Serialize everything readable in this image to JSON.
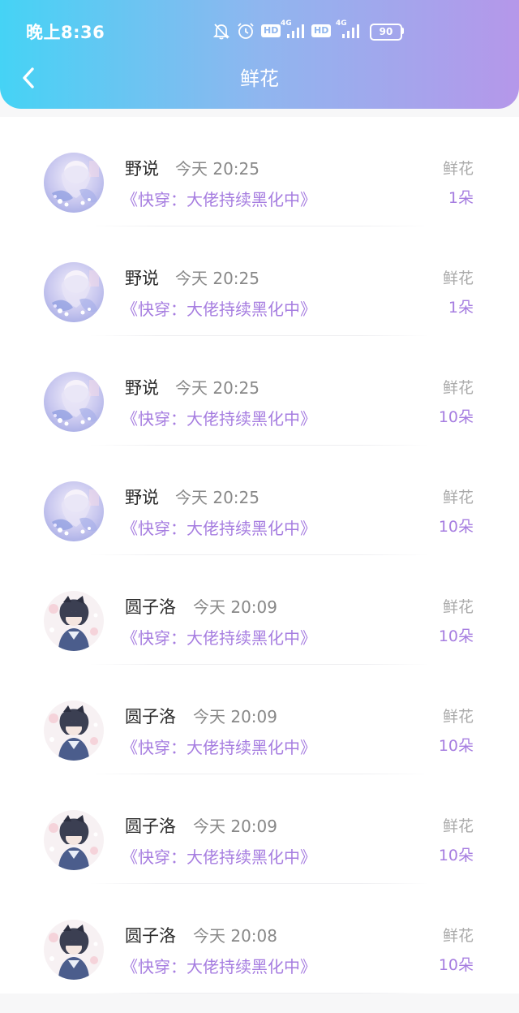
{
  "status_bar": {
    "time": "晚上8:36",
    "hd1": "HD",
    "hd2": "HD",
    "net1": "4G",
    "net2": "4G",
    "battery": "90",
    "icons": [
      "bell-muted-icon",
      "alarm-icon",
      "signal-icon",
      "signal-icon",
      "battery-icon"
    ]
  },
  "header": {
    "back_icon": "chevron-left-icon",
    "title": "鲜花"
  },
  "colors": {
    "header_gradient_start": "#45d3f5",
    "header_gradient_end": "#b597ea",
    "accent_purple": "#a67de0",
    "muted_gray": "#aaaaaa"
  },
  "items": [
    {
      "name": "野说",
      "time": "今天 20:25",
      "book": "《快穿：大佬持续黑化中》",
      "gift_label": "鲜花",
      "count": "1朵",
      "avatar": "anime-girl-avatar"
    },
    {
      "name": "野说",
      "time": "今天 20:25",
      "book": "《快穿：大佬持续黑化中》",
      "gift_label": "鲜花",
      "count": "1朵",
      "avatar": "anime-girl-avatar"
    },
    {
      "name": "野说",
      "time": "今天 20:25",
      "book": "《快穿：大佬持续黑化中》",
      "gift_label": "鲜花",
      "count": "10朵",
      "avatar": "anime-girl-avatar"
    },
    {
      "name": "野说",
      "time": "今天 20:25",
      "book": "《快穿：大佬持续黑化中》",
      "gift_label": "鲜花",
      "count": "10朵",
      "avatar": "anime-girl-avatar"
    },
    {
      "name": "圆子洛",
      "time": "今天 20:09",
      "book": "《快穿：大佬持续黑化中》",
      "gift_label": "鲜花",
      "count": "10朵",
      "avatar": "anime-boy-avatar"
    },
    {
      "name": "圆子洛",
      "time": "今天 20:09",
      "book": "《快穿：大佬持续黑化中》",
      "gift_label": "鲜花",
      "count": "10朵",
      "avatar": "anime-boy-avatar"
    },
    {
      "name": "圆子洛",
      "time": "今天 20:09",
      "book": "《快穿：大佬持续黑化中》",
      "gift_label": "鲜花",
      "count": "10朵",
      "avatar": "anime-boy-avatar"
    },
    {
      "name": "圆子洛",
      "time": "今天 20:08",
      "book": "《快穿：大佬持续黑化中》",
      "gift_label": "鲜花",
      "count": "10朵",
      "avatar": "anime-boy-avatar"
    }
  ]
}
